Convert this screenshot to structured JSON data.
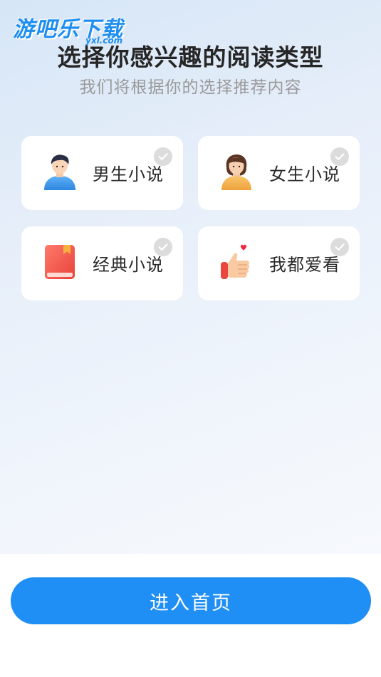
{
  "watermark": {
    "text": "游吧乐下载",
    "sub": "yxl.com"
  },
  "header": {
    "title": "选择你感兴趣的阅读类型",
    "subtitle": "我们将根据你的选择推荐内容"
  },
  "categories": [
    {
      "label": "男生小说",
      "icon": "boy-avatar-icon",
      "selected": false
    },
    {
      "label": "女生小说",
      "icon": "girl-avatar-icon",
      "selected": false
    },
    {
      "label": "经典小说",
      "icon": "red-book-icon",
      "selected": false
    },
    {
      "label": "我都爱看",
      "icon": "thumbs-up-heart-icon",
      "selected": false
    }
  ],
  "footer": {
    "enter_label": "进入首页"
  },
  "colors": {
    "accent": "#1f8ef5",
    "check_unselected": "#dcdcdc",
    "title": "#262626",
    "subtitle": "#9a9a9a"
  }
}
